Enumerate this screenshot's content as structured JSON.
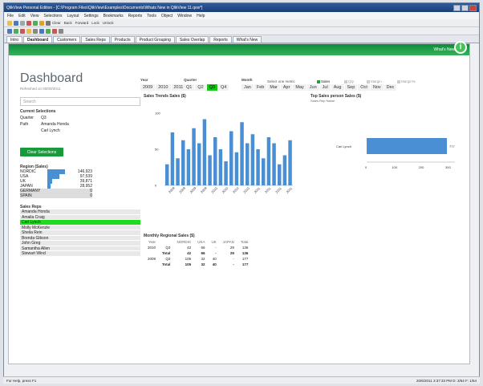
{
  "window": {
    "title": "QlikView Personal Edition - [C:\\Program Files\\QlikView\\Examples\\Documents\\Whats New in QlikView 11.qvw*]"
  },
  "menu": [
    "File",
    "Edit",
    "View",
    "Selections",
    "Layout",
    "Settings",
    "Bookmarks",
    "Reports",
    "Tools",
    "Object",
    "Window",
    "Help"
  ],
  "toolbar": {
    "clear_label": "Clear",
    "back_label": "Back",
    "forward_label": "Forward",
    "lock_label": "Lock",
    "unlock_label": "Unlock"
  },
  "tabs": [
    "Intro",
    "Dashboard",
    "Customers",
    "Sales Reps",
    "Products",
    "Product Grouping",
    "Sales Overlap",
    "Reports",
    "What's New"
  ],
  "whats_new": "What's New",
  "dashboard": {
    "title": "Dashboard",
    "refreshed": "Refreshed on 00/00/2011"
  },
  "filters": {
    "year_label": "Year",
    "years": [
      "2009",
      "2010",
      "2011"
    ],
    "quarter_label": "Quarter",
    "quarters": [
      "Q1",
      "Q2",
      "Q3",
      "Q4"
    ],
    "month_label": "Month",
    "months": [
      "Jan",
      "Feb",
      "Mar",
      "Apr",
      "May",
      "Jun",
      "Jul",
      "Aug",
      "Sep",
      "Oct",
      "Nov",
      "Dec"
    ],
    "selected_quarter": "Q3"
  },
  "metric": {
    "prompt": "Select one metric",
    "options": [
      "Sales",
      "Qty",
      "Margin",
      "Margin%"
    ],
    "selected": "Sales"
  },
  "search": {
    "placeholder": "Search"
  },
  "current_selections": {
    "title": "Current Selections",
    "rows": [
      {
        "field": "Quarter",
        "value": "Q3"
      },
      {
        "field": "Path",
        "value": "Amanda Honda"
      },
      {
        "field": "",
        "value": "Carl Lynch"
      }
    ]
  },
  "clear_button": "Clear Selections",
  "region": {
    "title": "Region (Sales)",
    "rows": [
      {
        "name": "NORDIC",
        "value": "146,923",
        "ratio": 1.0
      },
      {
        "name": "USA",
        "value": "97,539",
        "ratio": 0.66
      },
      {
        "name": "UK",
        "value": "39,871",
        "ratio": 0.27
      },
      {
        "name": "JAPAN",
        "value": "28,952",
        "ratio": 0.2
      },
      {
        "name": "GERMANY",
        "value": "0",
        "ratio": 0
      },
      {
        "name": "SPAIN",
        "value": "0",
        "ratio": 0
      }
    ]
  },
  "sales_reps": {
    "title": "Sales Reps",
    "items": [
      "Amanda Honda",
      "Amalia Craig",
      "Carl Lynch",
      "Molly McKenzie",
      "Sheila Rein",
      "Brenda Gibson",
      "John Greg",
      "Samantha Allen",
      "Stewart Wind"
    ],
    "selected": "Carl Lynch"
  },
  "trend": {
    "title": "Sales Trends Sales ($)",
    "ylabels": [
      "100",
      "50",
      "0"
    ]
  },
  "topsales": {
    "title": "Top Sales person Sales ($)",
    "subtitle": "Sales Rep Name",
    "label": "Carl Lynch",
    "value": "777",
    "ticks": [
      "0",
      "100",
      "200",
      "300"
    ]
  },
  "chart_data": [
    {
      "type": "bar",
      "title": "Sales Trends Sales ($)",
      "categories": [
        "2009",
        "2009",
        "2009",
        "2009",
        "2010",
        "2010",
        "2010",
        "2010",
        "2011",
        "2011",
        "2011",
        "2011"
      ],
      "values": [
        35,
        88,
        45,
        75,
        60,
        95,
        70,
        110,
        50,
        80,
        60,
        40,
        90,
        55,
        105,
        70,
        85,
        60,
        45,
        80,
        70,
        35,
        50,
        75
      ],
      "ylim": [
        0,
        120
      ]
    },
    {
      "type": "bar",
      "title": "Top Sales person Sales ($)",
      "categories": [
        "Carl Lynch"
      ],
      "values": [
        300
      ],
      "xlim": [
        0,
        330
      ]
    }
  ],
  "pivot": {
    "title": "Monthly Regional Sales ($)",
    "headers": [
      "Year",
      "",
      "NORDIC",
      "USA",
      "UK",
      "JAPAN",
      "Total"
    ],
    "rows": [
      {
        "year": "2010",
        "q": "Q3",
        "v": [
          "42",
          "66",
          "-",
          "29",
          "136"
        ]
      },
      {
        "year": "",
        "q": "Total",
        "v": [
          "42",
          "66",
          "-",
          "29",
          "136"
        ]
      },
      {
        "year": "2009",
        "q": "Q3",
        "v": [
          "105",
          "32",
          "40",
          "-",
          "177"
        ]
      },
      {
        "year": "",
        "q": "Total",
        "v": [
          "105",
          "32",
          "40",
          "-",
          "177"
        ]
      }
    ]
  },
  "status": {
    "left": "For Help, press F1",
    "right": "20/6/2011 3:37:33 PM    D: 3/64  F: 1/64"
  },
  "colors": {
    "accent": "#1a9b3b",
    "bars": "#4a8fd4",
    "selected": "#17c417"
  }
}
